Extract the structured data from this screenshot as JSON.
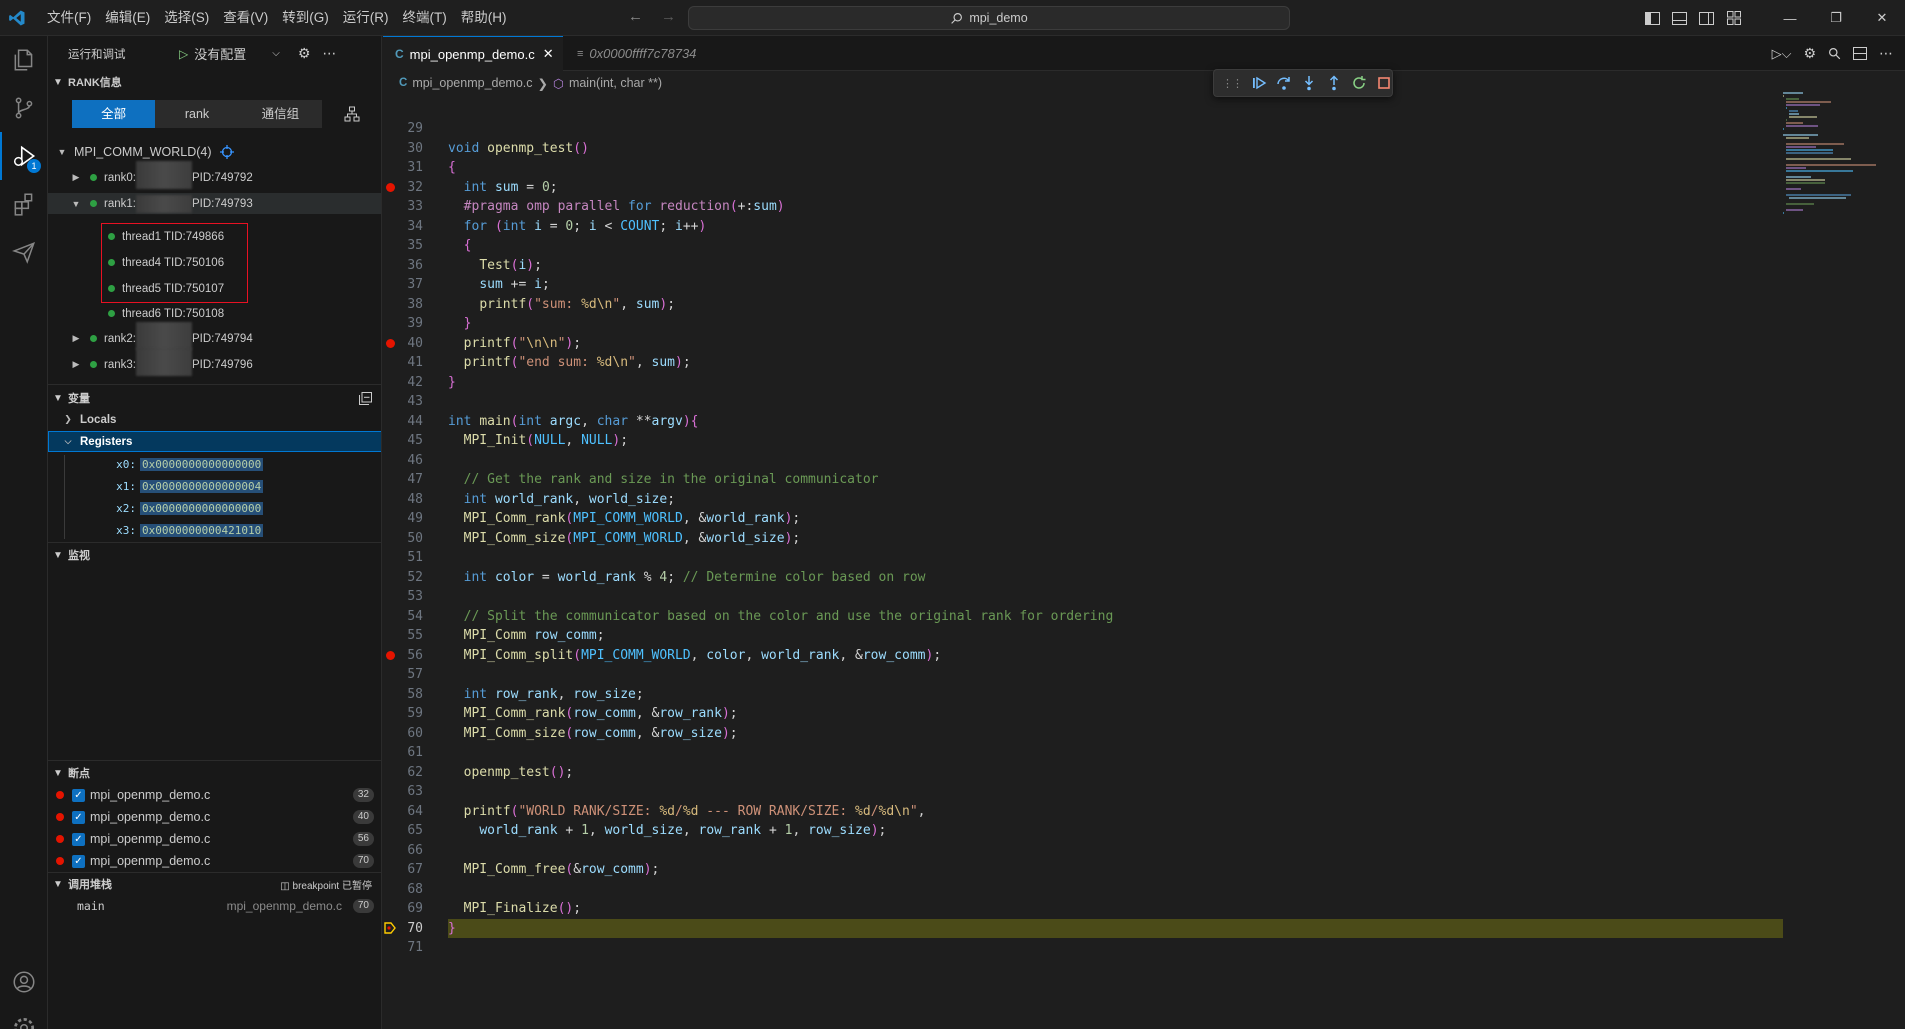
{
  "menu": [
    "文件(F)",
    "编辑(E)",
    "选择(S)",
    "查看(V)",
    "转到(G)",
    "运行(R)",
    "终端(T)",
    "帮助(H)"
  ],
  "search": {
    "text": "mpi_demo"
  },
  "sidebar": {
    "title": "运行和调试",
    "config": "没有配置",
    "rank_section": "RANK信息",
    "segments": [
      "全部",
      "rank",
      "通信组"
    ],
    "world": "MPI_COMM_WORLD(4)",
    "ranks": [
      {
        "name": "rank0:",
        "pid": "PID:749792"
      },
      {
        "name": "rank1:",
        "pid": "PID:749793"
      },
      {
        "name": "rank2:",
        "pid": "PID:749794"
      },
      {
        "name": "rank3:",
        "pid": "PID:749796"
      }
    ],
    "threads": [
      "thread1 TID:749866",
      "thread4 TID:750106",
      "thread5 TID:750107",
      "thread6 TID:750108"
    ],
    "variables_section": "变量",
    "locals": "Locals",
    "registers": "Registers",
    "regs": [
      {
        "name": "x0:",
        "value": "0x0000000000000000"
      },
      {
        "name": "x1:",
        "value": "0x0000000000000004"
      },
      {
        "name": "x2:",
        "value": "0x0000000000000000"
      },
      {
        "name": "x3:",
        "value": "0x0000000000421010"
      }
    ],
    "watch_section": "监视",
    "breakpoints_section": "断点",
    "breakpoints": [
      {
        "file": "mpi_openmp_demo.c",
        "line": "32"
      },
      {
        "file": "mpi_openmp_demo.c",
        "line": "40"
      },
      {
        "file": "mpi_openmp_demo.c",
        "line": "56"
      },
      {
        "file": "mpi_openmp_demo.c",
        "line": "70"
      }
    ],
    "callstack_section": "调用堆栈",
    "callstack_status": "breakpoint 已暂停",
    "callstack_frame": {
      "name": "main",
      "file": "mpi_openmp_demo.c",
      "line": "70"
    }
  },
  "editor": {
    "tab_active": "mpi_openmp_demo.c",
    "tab_inactive": "0x0000ffff7c78734",
    "breadcrumb_file": "mpi_openmp_demo.c",
    "breadcrumb_symbol": "main(int, char **)"
  },
  "code_lines": [
    {
      "n": "29",
      "t": ""
    },
    {
      "n": "30",
      "t": "void openmp_test()"
    },
    {
      "n": "31",
      "t": "{"
    },
    {
      "n": "32",
      "t": "  int sum = 0;",
      "bp": true
    },
    {
      "n": "33",
      "t": "  #pragma omp parallel for reduction(+:sum)"
    },
    {
      "n": "34",
      "t": "  for (int i = 0; i < COUNT; i++)"
    },
    {
      "n": "35",
      "t": "  {"
    },
    {
      "n": "36",
      "t": "    Test(i);"
    },
    {
      "n": "37",
      "t": "    sum += i;"
    },
    {
      "n": "38",
      "t": "    printf(\"sum: %d\\n\", sum);"
    },
    {
      "n": "39",
      "t": "  }"
    },
    {
      "n": "40",
      "t": "  printf(\"\\n\\n\");",
      "bp": true
    },
    {
      "n": "41",
      "t": "  printf(\"end sum: %d\\n\", sum);"
    },
    {
      "n": "42",
      "t": "}"
    },
    {
      "n": "43",
      "t": ""
    },
    {
      "n": "44",
      "t": "int main(int argc, char **argv){"
    },
    {
      "n": "45",
      "t": "  MPI_Init(NULL, NULL);"
    },
    {
      "n": "46",
      "t": ""
    },
    {
      "n": "47",
      "t": "  // Get the rank and size in the original communicator"
    },
    {
      "n": "48",
      "t": "  int world_rank, world_size;"
    },
    {
      "n": "49",
      "t": "  MPI_Comm_rank(MPI_COMM_WORLD, &world_rank);"
    },
    {
      "n": "50",
      "t": "  MPI_Comm_size(MPI_COMM_WORLD, &world_size);"
    },
    {
      "n": "51",
      "t": ""
    },
    {
      "n": "52",
      "t": "  int color = world_rank % 4; // Determine color based on row"
    },
    {
      "n": "53",
      "t": ""
    },
    {
      "n": "54",
      "t": "  // Split the communicator based on the color and use the original rank for ordering"
    },
    {
      "n": "55",
      "t": "  MPI_Comm row_comm;"
    },
    {
      "n": "56",
      "t": "  MPI_Comm_split(MPI_COMM_WORLD, color, world_rank, &row_comm);",
      "bp": true
    },
    {
      "n": "57",
      "t": ""
    },
    {
      "n": "58",
      "t": "  int row_rank, row_size;"
    },
    {
      "n": "59",
      "t": "  MPI_Comm_rank(row_comm, &row_rank);"
    },
    {
      "n": "60",
      "t": "  MPI_Comm_size(row_comm, &row_size);"
    },
    {
      "n": "61",
      "t": ""
    },
    {
      "n": "62",
      "t": "  openmp_test();"
    },
    {
      "n": "63",
      "t": ""
    },
    {
      "n": "64",
      "t": "  printf(\"WORLD RANK/SIZE: %d/%d --- ROW RANK/SIZE: %d/%d\\n\","
    },
    {
      "n": "65",
      "t": "    world_rank + 1, world_size, row_rank + 1, row_size);"
    },
    {
      "n": "66",
      "t": ""
    },
    {
      "n": "67",
      "t": "  MPI_Comm_free(&row_comm);"
    },
    {
      "n": "68",
      "t": ""
    },
    {
      "n": "69",
      "t": "  MPI_Finalize();"
    },
    {
      "n": "70",
      "t": "}",
      "current": true
    },
    {
      "n": "71",
      "t": ""
    }
  ],
  "colors": {
    "accent": "#0e70c0",
    "breakpoint": "#e51400",
    "current_line": "#4b4b18",
    "thread_dot": "#2ea043"
  }
}
